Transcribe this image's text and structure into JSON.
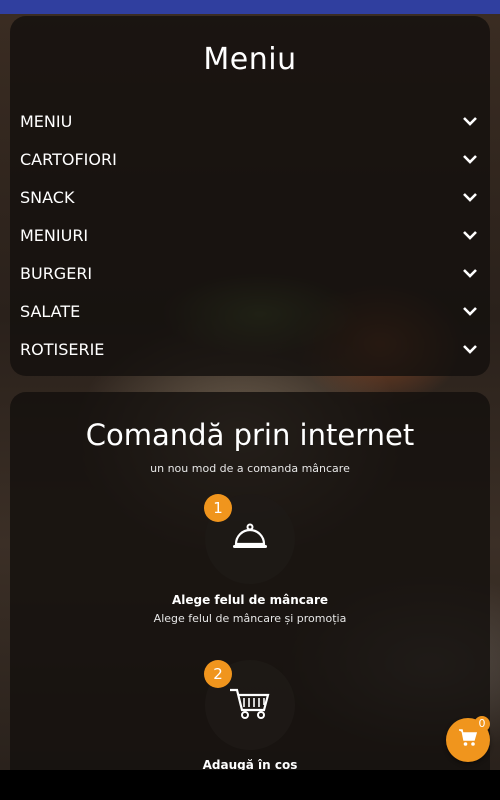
{
  "menu": {
    "title": "Meniu",
    "items": [
      {
        "label": "MENIU"
      },
      {
        "label": "CARTOFIORI"
      },
      {
        "label": "SNACK"
      },
      {
        "label": "MENIURI"
      },
      {
        "label": "BURGERI"
      },
      {
        "label": "SALATE"
      },
      {
        "label": "ROTISERIE"
      }
    ]
  },
  "order": {
    "title": "Comandă prin internet",
    "subtitle": "un nou mod de a comanda mâncare",
    "steps": [
      {
        "number": "1",
        "icon": "cloche-icon",
        "label": "Alege felul de mâncare",
        "desc": "Alege felul de mâncare și promoția"
      },
      {
        "number": "2",
        "icon": "shopping-cart-icon",
        "label": "Adaugă în coș",
        "desc": ""
      }
    ]
  },
  "cart": {
    "count": "0",
    "icon": "cart-icon"
  },
  "colors": {
    "accent": "#f0951d",
    "statusbar": "#303f9f"
  }
}
